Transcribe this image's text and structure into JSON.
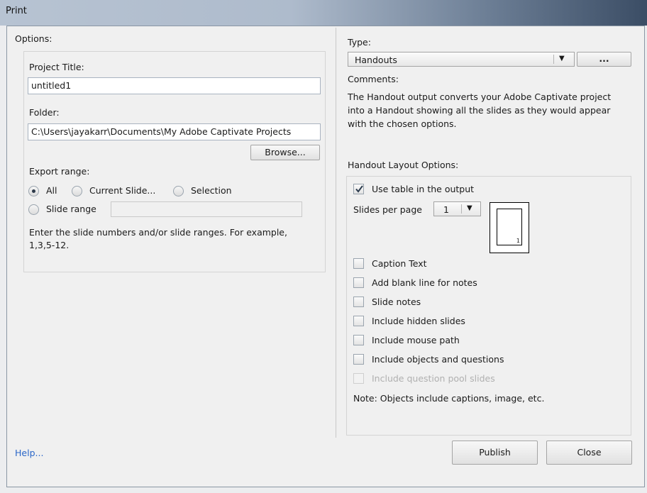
{
  "window": {
    "title": "Print"
  },
  "left": {
    "group_label": "Options:",
    "project_title_label": "Project Title:",
    "project_title_value": "untitled1",
    "folder_label": "Folder:",
    "folder_value": "C:\\Users\\jayakarr\\Documents\\My Adobe Captivate Projects",
    "browse_label": "Browse...",
    "export_range_label": "Export range:",
    "radio_all": "All",
    "radio_current": "Current Slide...",
    "radio_selection": "Selection",
    "radio_slide_range": "Slide range",
    "slide_range_value": "",
    "hint_line1": "Enter the slide numbers and/or slide ranges. For example,",
    "hint_line2": "1,3,5-12."
  },
  "right": {
    "type_label": "Type:",
    "type_value": "Handouts",
    "more_button_label": "...",
    "comments_label": "Comments:",
    "comments_line1": "The Handout output converts your Adobe Captivate project",
    "comments_line2": "into a Handout showing all the slides as they would appear",
    "comments_line3": "with the chosen options.",
    "layout_label": "Handout Layout Options:",
    "use_table_label": "Use table in the output",
    "use_table_checked": true,
    "slides_per_page_label": "Slides per page",
    "slides_per_page_value": "1",
    "preview_number": "1",
    "options": [
      {
        "label": "Caption Text",
        "checked": false,
        "enabled": true
      },
      {
        "label": "Add blank line for notes",
        "checked": false,
        "enabled": true
      },
      {
        "label": "Slide notes",
        "checked": false,
        "enabled": true
      },
      {
        "label": "Include hidden slides",
        "checked": false,
        "enabled": true
      },
      {
        "label": "Include mouse path",
        "checked": false,
        "enabled": true
      },
      {
        "label": "Include objects and questions",
        "checked": false,
        "enabled": true
      },
      {
        "label": "Include question pool slides",
        "checked": false,
        "enabled": false
      }
    ],
    "note": "Note: Objects include captions, image, etc."
  },
  "footer": {
    "help_label": "Help...",
    "publish_label": "Publish",
    "close_label": "Close"
  }
}
